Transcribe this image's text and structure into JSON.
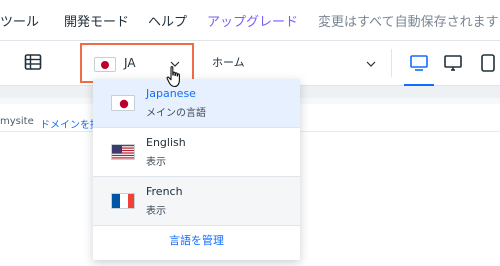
{
  "menubar": {
    "items": [
      {
        "label": "ツール"
      },
      {
        "label": "開発モード"
      },
      {
        "label": "ヘルプ"
      },
      {
        "label": "アップグレード"
      }
    ],
    "status": "変更はすべて自動保存されます"
  },
  "toolbar": {
    "language_code": "JA",
    "page": "ホーム"
  },
  "url": {
    "site": "mysite",
    "link": "ドメインを接"
  },
  "dropdown": {
    "options": [
      {
        "name": "Japanese",
        "subtitle": "メインの言語",
        "flag": "japan-flag"
      },
      {
        "name": "English",
        "subtitle": "表示",
        "flag": "usa-flag"
      },
      {
        "name": "French",
        "subtitle": "表示",
        "flag": "france-flag"
      }
    ],
    "manage_label": "言語を管理"
  },
  "colors": {
    "accent": "#116dff",
    "upgrade": "#7c5cf5",
    "highlight_border": "#f26b47"
  }
}
